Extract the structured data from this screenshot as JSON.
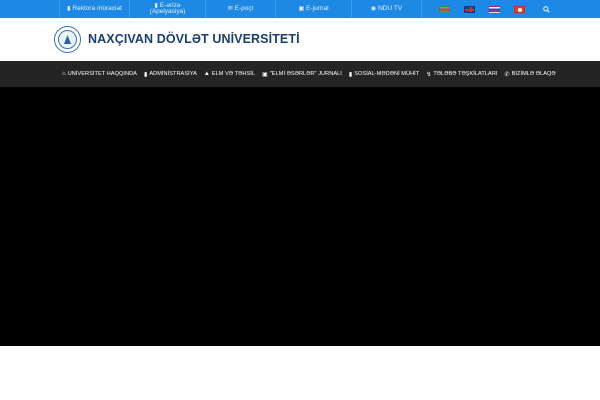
{
  "topbar": {
    "items": [
      {
        "icon": "document-icon",
        "label": "Rektora müraciət"
      },
      {
        "icon": "document-icon",
        "label_line1": "E-ərizə",
        "label_line2": "(Apelyasiya)"
      },
      {
        "icon": "envelope-icon",
        "label": "E-poçt"
      },
      {
        "icon": "monitor-icon",
        "label": "E-jurnal"
      },
      {
        "icon": "play-circle-icon",
        "label": "NDU TV"
      }
    ],
    "languages": [
      "az",
      "en",
      "ru",
      "tr"
    ],
    "search_icon": "search-icon",
    "bg_color": "#1e88e5"
  },
  "header": {
    "title": "NAXÇIVAN DÖVLƏT UNİVERSİTETİ",
    "logo_icon": "university-seal"
  },
  "nav": {
    "items": [
      {
        "icon": "home-icon",
        "label": "UNİVERSİTET HAQQINDA"
      },
      {
        "icon": "bookmark-icon",
        "label": "ADMİNİSTRASİYA"
      },
      {
        "icon": "graduation-cap-icon",
        "label": "ELM VƏ TƏHSİL"
      },
      {
        "icon": "book-icon",
        "label": "\"ELMİ ƏSƏRLƏR\" JURNALI"
      },
      {
        "icon": "file-icon",
        "label": "SOSİAL-MƏDƏNİ MÜHİT"
      },
      {
        "icon": "bolt-icon",
        "label": "TƏLƏBƏ TƏŞKİLATLARI"
      },
      {
        "icon": "phone-icon",
        "label": "BİZİMLƏ ƏLAQƏ"
      }
    ],
    "bg_color": "#242424"
  },
  "hero": {
    "bg_color": "#000000"
  }
}
